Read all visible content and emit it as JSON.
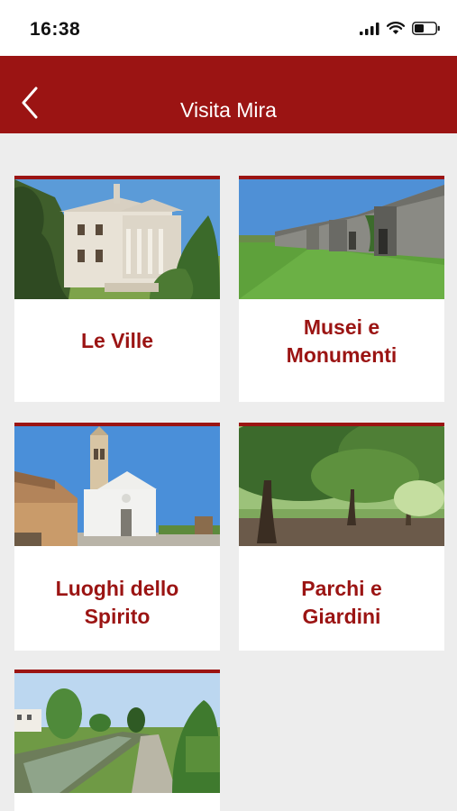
{
  "status": {
    "time": "16:38"
  },
  "header": {
    "title": "Visita Mira"
  },
  "cards": [
    {
      "label_line1": "Le Ville",
      "label_line2": "",
      "image": "villa-photo"
    },
    {
      "label_line1": "Musei e",
      "label_line2": "Monumenti",
      "image": "fortress-photo"
    },
    {
      "label_line1": "Luoghi dello",
      "label_line2": "Spirito",
      "image": "church-photo"
    },
    {
      "label_line1": "Parchi e",
      "label_line2": "Giardini",
      "image": "park-photo"
    },
    {
      "label_line1": "",
      "label_line2": "",
      "image": "canal-photo"
    }
  ],
  "colors": {
    "brand": "#9b1413",
    "background": "#ededed"
  }
}
